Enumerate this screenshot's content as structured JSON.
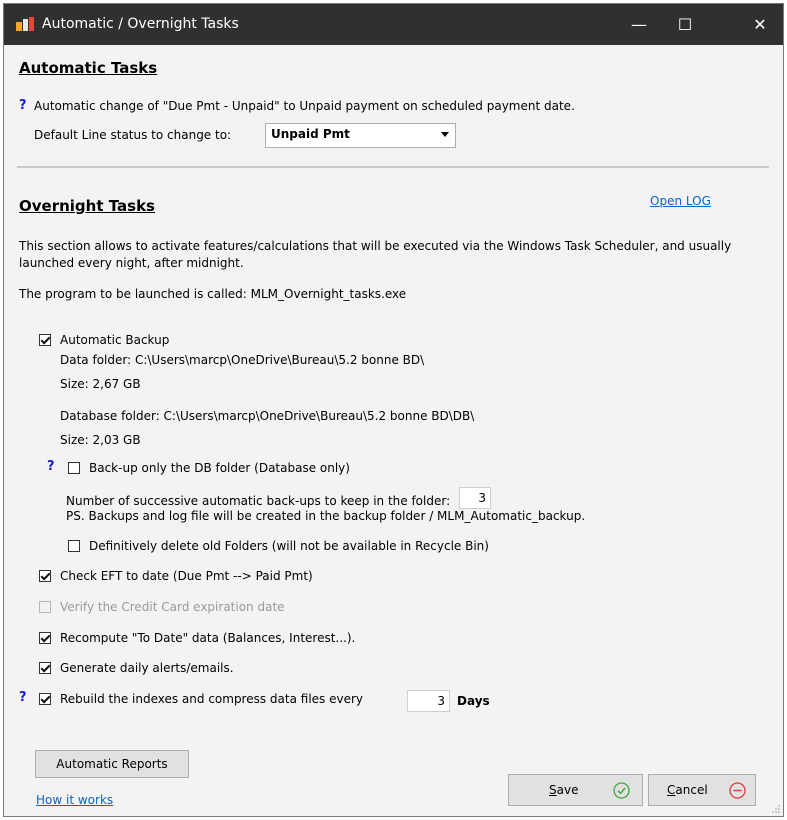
{
  "window": {
    "title": "Automatic / Overnight Tasks",
    "controls": [
      "minimize-icon",
      "maximize-icon",
      "close-icon"
    ],
    "control_glyphs": {
      "minimize": "—",
      "maximize": "☐",
      "close": "✕"
    }
  },
  "automatic": {
    "heading": "Automatic Tasks",
    "help_mark": "?",
    "description": "Automatic change of \"Due Pmt - Unpaid\" to Unpaid payment on scheduled payment date.",
    "line_status_label": "Default Line status to change to:",
    "line_status_value": "Unpaid Pmt"
  },
  "overnight": {
    "heading": "Overnight Tasks",
    "open_log": "Open LOG",
    "intro_line1": "This section allows to activate features/calculations that will be executed via the Windows Task Scheduler, and usually",
    "intro_line2": "launched every night, after midnight.",
    "program_line": "The program to be launched is called: MLM_Overnight_tasks.exe",
    "backup": {
      "label": "Automatic Backup",
      "checked": true,
      "data_folder": "Data folder: C:\\Users\\marcp\\OneDrive\\Bureau\\5.2 bonne BD\\",
      "data_size": "Size: 2,67 GB",
      "db_folder": "Database folder: C:\\Users\\marcp\\OneDrive\\Bureau\\5.2 bonne BD\\DB\\",
      "db_size": "Size: 2,03 GB",
      "db_only_help": "?",
      "db_only_label": "Back-up only the DB folder (Database only)",
      "db_only_checked": false,
      "keep_label": "Number of successive automatic back-ups to keep in the folder:",
      "keep_value": "3",
      "ps_note": "PS. Backups and log file will be created in the backup folder / MLM_Automatic_backup.",
      "delete_label": "Definitively delete old Folders (will not be available in Recycle Bin)",
      "delete_checked": false
    },
    "eft": {
      "label": "Check EFT to date (Due Pmt --> Paid Pmt)",
      "checked": true
    },
    "credit_card": {
      "label": "Verify the Credit Card expiration date",
      "checked": false,
      "disabled": true
    },
    "recompute": {
      "label": "Recompute \"To Date\" data (Balances, Interest...).",
      "checked": true
    },
    "alerts": {
      "label": "Generate daily alerts/emails.",
      "checked": true
    },
    "rebuild": {
      "help": "?",
      "label": "Rebuild the indexes and compress data files every",
      "checked": true,
      "days_value": "3",
      "days_label": "Days"
    }
  },
  "footer": {
    "reports_button": "Automatic Reports",
    "how_it_works": "How it works",
    "save": {
      "label_first": "S",
      "label_rest": "ave",
      "icon": "check-circle-icon",
      "color": "#3aa83a"
    },
    "cancel": {
      "label_first": "C",
      "label_rest": "ancel",
      "icon": "minus-circle-icon",
      "color": "#e03a3a"
    }
  }
}
